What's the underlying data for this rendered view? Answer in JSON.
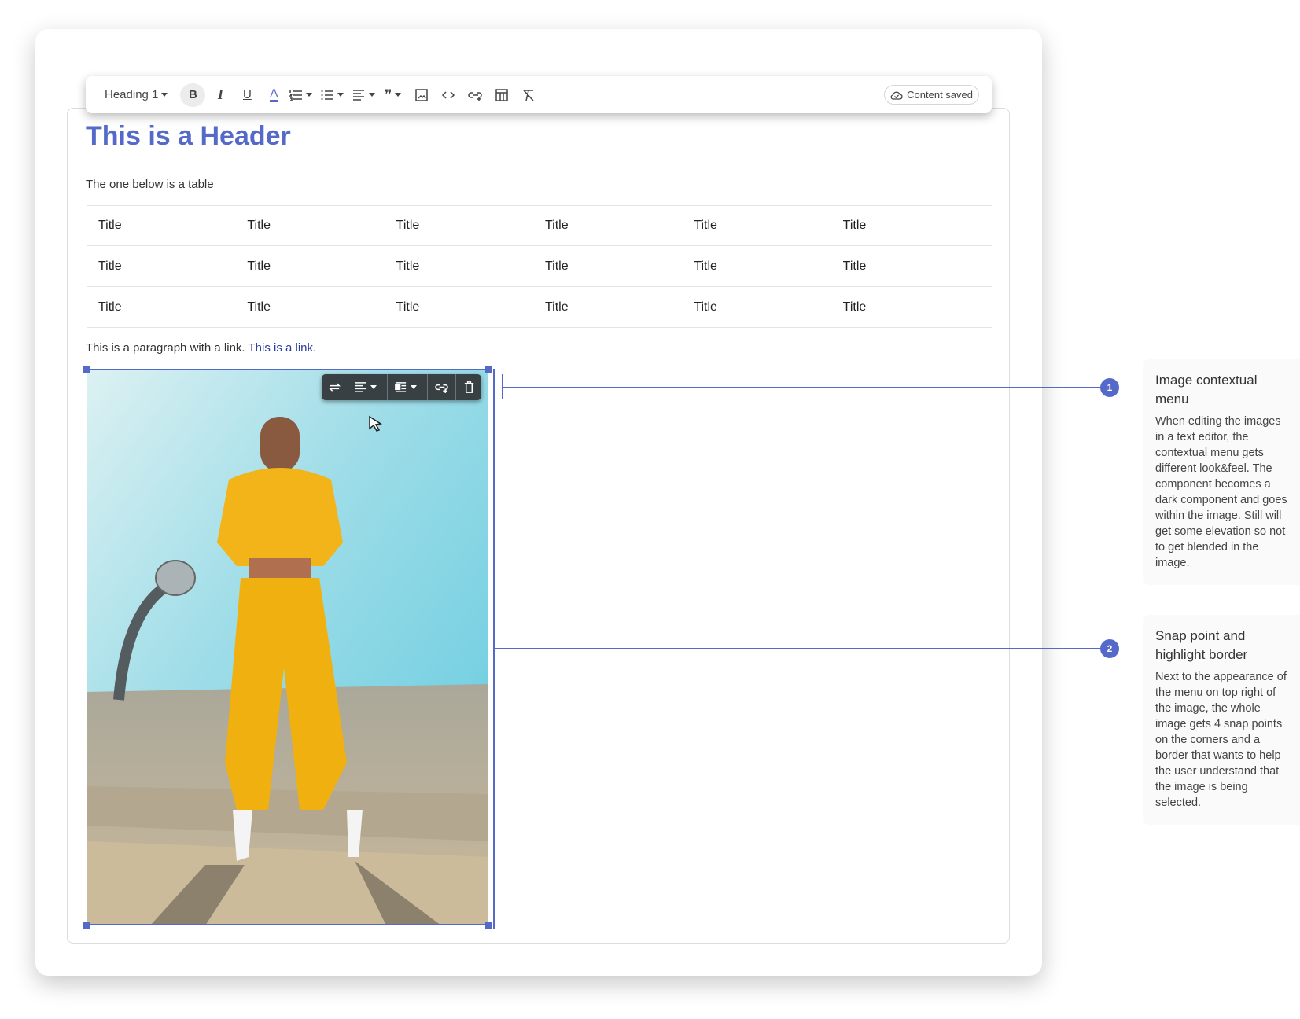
{
  "toolbar": {
    "style_select": "Heading 1",
    "bold": "B",
    "status": "Content saved",
    "tools": [
      "bold-icon",
      "italic-icon",
      "underline-icon",
      "text-color-icon",
      "ordered-list-icon",
      "bullet-list-icon",
      "align-icon",
      "quote-icon",
      "image-icon",
      "code-icon",
      "link-icon",
      "table-icon",
      "clear-format-icon"
    ]
  },
  "content": {
    "heading": "This is a Header",
    "intro": "The one below is a table",
    "table": [
      [
        "Title",
        "Title",
        "Title",
        "Title",
        "Title",
        "Title"
      ],
      [
        "Title",
        "Title",
        "Title",
        "Title",
        "Title",
        "Title"
      ],
      [
        "Title",
        "Title",
        "Title",
        "Title",
        "Title",
        "Title"
      ]
    ],
    "paragraph": "This is a paragraph with a link. ",
    "link": "This is a link."
  },
  "image_menu": [
    "swap-icon",
    "align-icon",
    "wrap-icon",
    "link-icon",
    "delete-icon"
  ],
  "colors": {
    "accent": "#5469c8",
    "menu_dark": "#384044",
    "link": "#2a3e9e"
  },
  "annotations": [
    {
      "number": "1",
      "title": "Image contextual menu",
      "body": "When editing the images in a text editor, the contextual menu gets different look&feel. The component becomes a dark component and goes within the image. Still will get some elevation so not to get blended in the image."
    },
    {
      "number": "2",
      "title": "Snap point and highlight border",
      "body": "Next to the appearance of the menu on top right of the image, the whole image gets 4 snap points on the corners and a border that wants to help the user understand that the image is being selected."
    }
  ]
}
